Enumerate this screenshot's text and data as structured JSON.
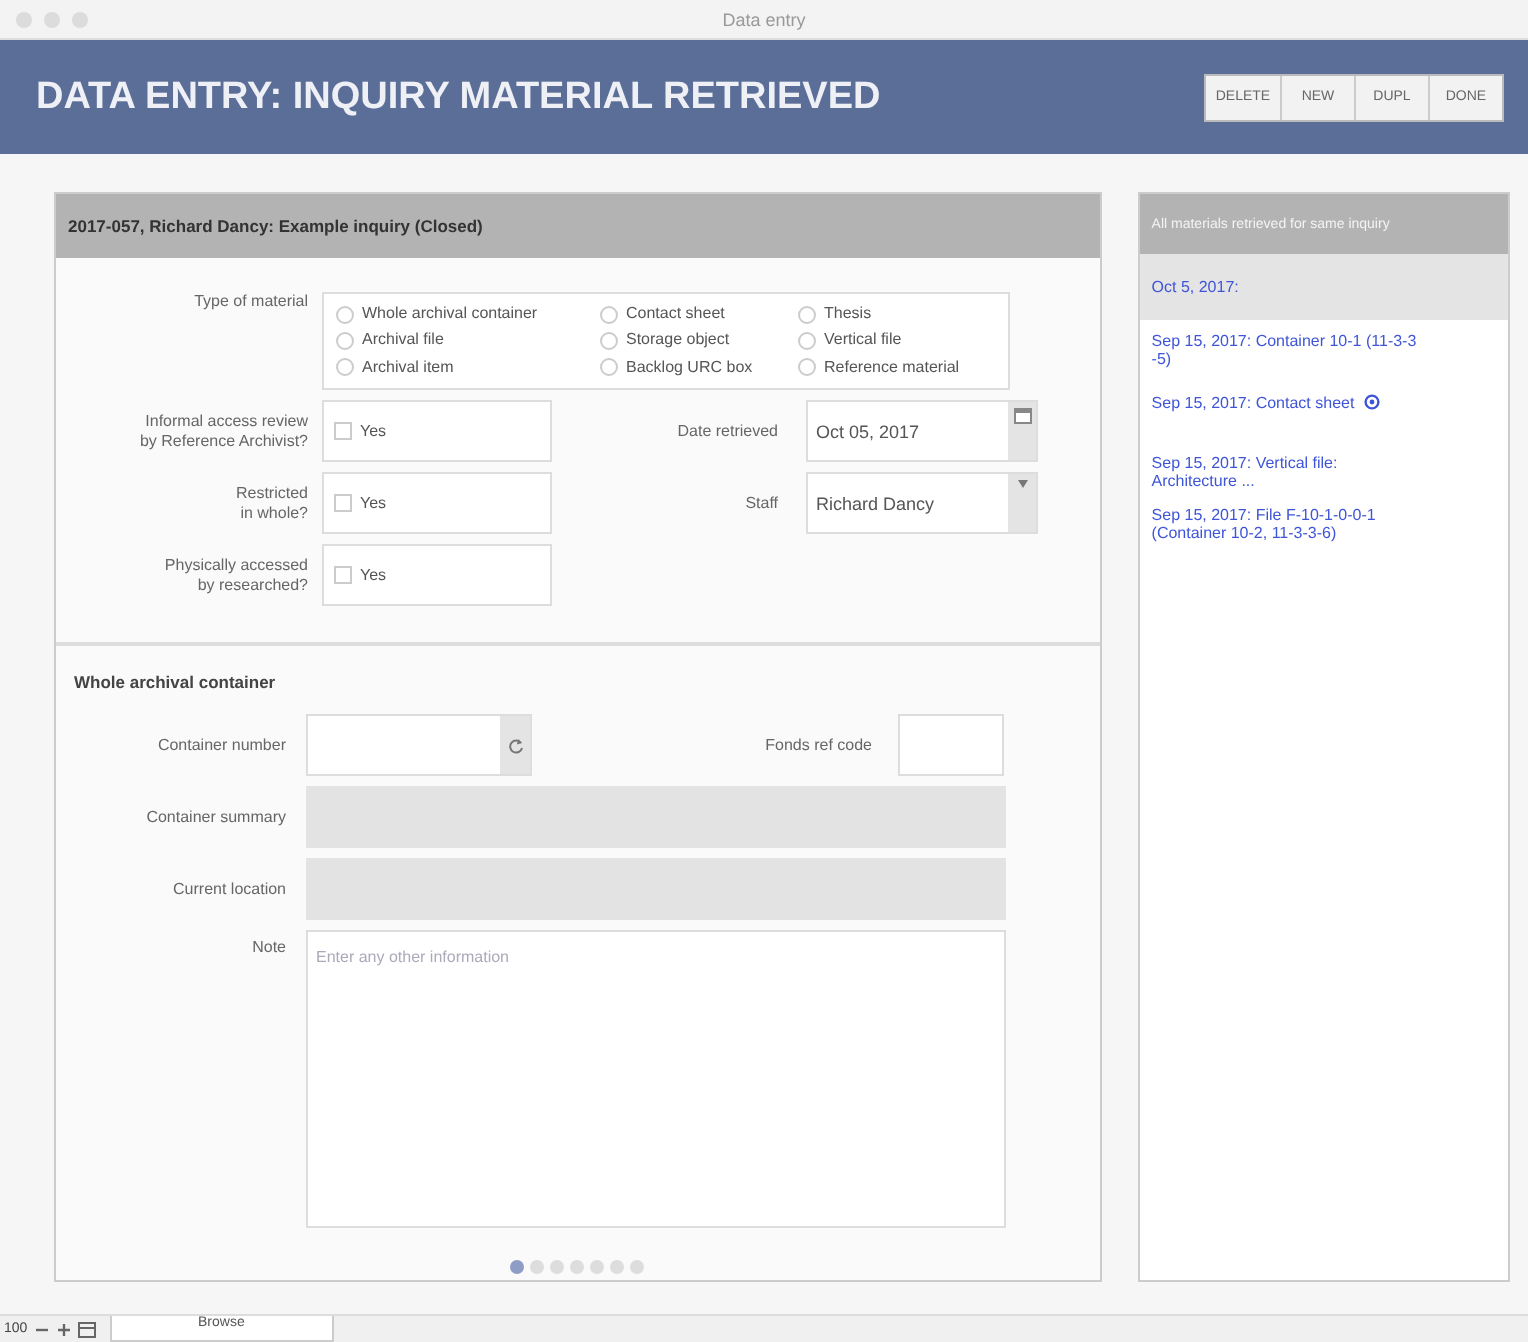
{
  "window": {
    "title": "Data entry"
  },
  "header": {
    "title": "DATA ENTRY: INQUIRY MATERIAL RETRIEVED",
    "buttons": [
      "DELETE",
      "NEW",
      "DUPL",
      "DONE"
    ]
  },
  "record": {
    "title": "2017-057, Richard Dancy: Example inquiry (Closed)",
    "type_of_material": {
      "label": "Type of material",
      "options": [
        {
          "label": "Whole archival container",
          "selected": false
        },
        {
          "label": "Contact sheet",
          "selected": false
        },
        {
          "label": "Thesis",
          "selected": false
        },
        {
          "label": "Archival file",
          "selected": false
        },
        {
          "label": "Storage object",
          "selected": false
        },
        {
          "label": "Vertical file",
          "selected": false
        },
        {
          "label": "Archival item",
          "selected": false
        },
        {
          "label": "Backlog URC box",
          "selected": false
        },
        {
          "label": "Reference material",
          "selected": false
        }
      ]
    },
    "checks": [
      {
        "label": "Informal access review\nby Reference Archivist?",
        "option": "Yes",
        "checked": false
      },
      {
        "label": "Restricted\nin whole?",
        "option": "Yes",
        "checked": false
      },
      {
        "label": "Physically accessed\nby researched?",
        "option": "Yes",
        "checked": false
      }
    ],
    "date_retrieved": {
      "label": "Date retrieved",
      "value": "Oct 05, 2017"
    },
    "staff": {
      "label": "Staff",
      "value": "Richard Dancy"
    }
  },
  "container": {
    "title": "Whole archival container",
    "container_number": {
      "label": "Container number"
    },
    "fonds_ref_code": {
      "label": "Fonds ref code"
    },
    "container_summary": {
      "label": "Container summary"
    },
    "current_location": {
      "label": "Current location"
    },
    "note": {
      "label": "Note",
      "placeholder": "Enter any other information"
    }
  },
  "pages": [
    {
      "selected": true
    },
    {
      "selected": false
    },
    {
      "selected": false
    },
    {
      "selected": false
    },
    {
      "selected": false
    },
    {
      "selected": false
    },
    {
      "selected": false
    }
  ],
  "side_panel": {
    "title": "All materials retrieved for same inquiry",
    "date": "Oct 5, 2017:",
    "items": [
      {
        "text": "Sep 15, 2017: Container 10-1 (11-3-3\n-5)",
        "attachment": false
      },
      {
        "text": "Sep 15, 2017: Contact sheet",
        "attachment": true
      },
      {
        "text": "Sep 15, 2017: Vertical file:\nArchitecture ...",
        "attachment": false
      },
      {
        "text": "Sep 15, 2017: File F-10-1-0-0-1\n(Container 10-2, 11-3-3-6)",
        "attachment": false
      }
    ]
  },
  "status_bar": {
    "zoom": "100",
    "mode": "Browse"
  }
}
